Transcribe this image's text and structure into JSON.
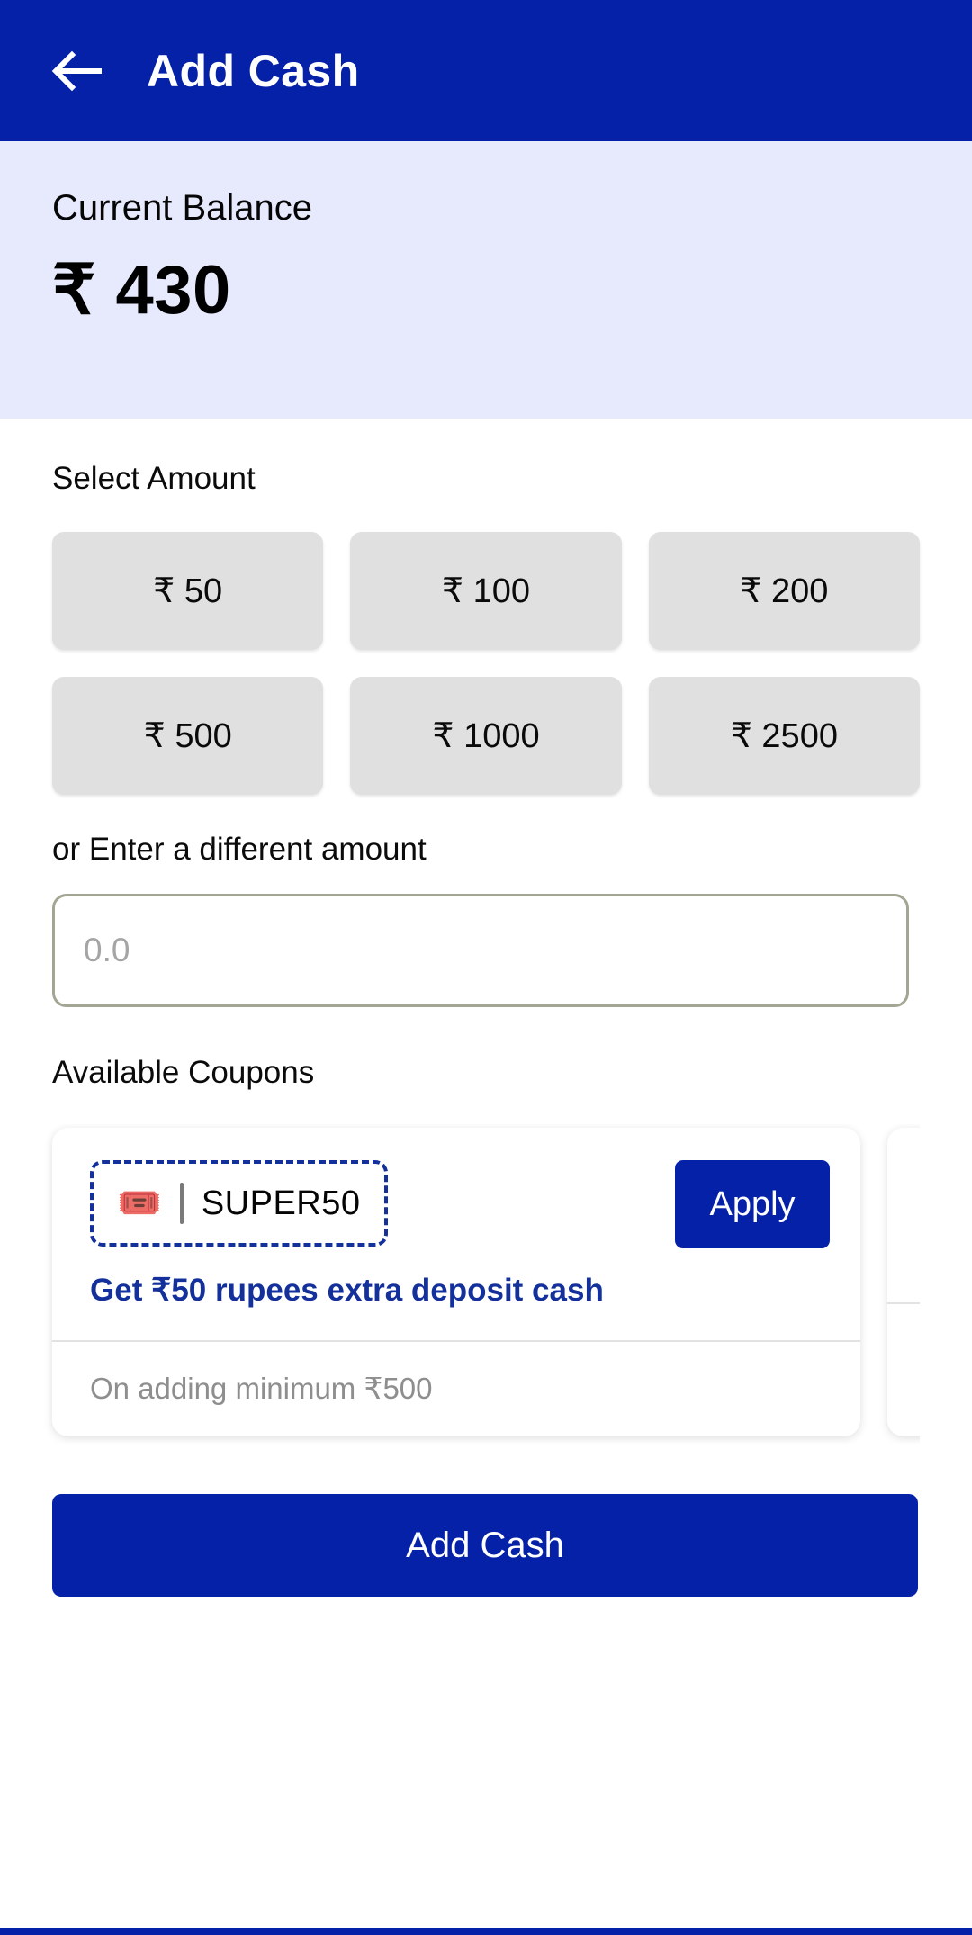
{
  "appbar": {
    "back_icon": "arrow-left-icon",
    "title": "Add Cash"
  },
  "balance": {
    "label": "Current Balance",
    "amount": "₹ 430"
  },
  "select_amount": {
    "label": "Select Amount",
    "chips": [
      "₹ 50",
      "₹ 100",
      "₹ 200",
      "₹ 500",
      "₹ 1000",
      "₹ 2500"
    ]
  },
  "custom_amount": {
    "label": "or Enter a different amount",
    "value": "",
    "placeholder": "0.0"
  },
  "coupons": {
    "label": "Available Coupons",
    "items": [
      {
        "icon": "🎟️",
        "code": "SUPER50",
        "apply_label": "Apply",
        "description": "Get ₹50 rupees extra deposit cash",
        "condition": "On adding minimum ₹500"
      },
      {
        "icon": "",
        "code": "",
        "apply_label": "",
        "description": "",
        "condition": ""
      }
    ]
  },
  "cta": {
    "label": "Add Cash"
  },
  "colors": {
    "brand_blue": "#0521a8",
    "balance_band": "#e7eafc",
    "chip_gray": "#e0e0e0",
    "coupon_navy": "#13309b",
    "input_border": "#a3a693"
  }
}
